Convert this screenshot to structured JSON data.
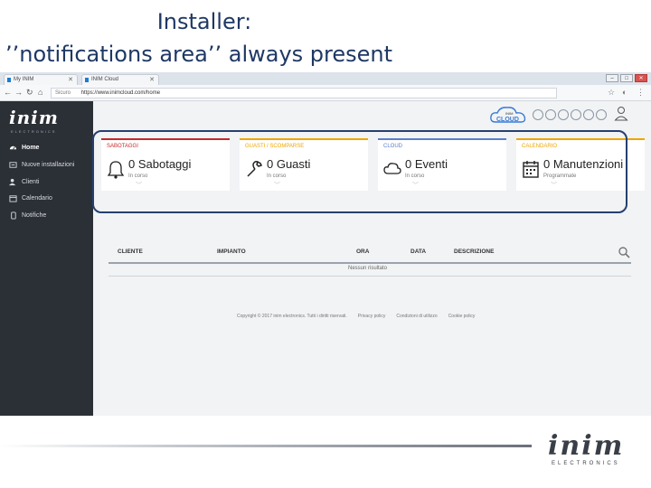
{
  "slide": {
    "title_line1": "Installer:",
    "title_line2": "’’notifications area’’ always present",
    "brand_name": "inim",
    "brand_sub": "ELECTRONICS"
  },
  "browser": {
    "tabs": [
      {
        "label": "My INIM"
      },
      {
        "label": "INIM Cloud"
      }
    ],
    "url_security": "Sicuro",
    "url": "https://www.inimcloud.com/home"
  },
  "sidebar": {
    "logo": "inim",
    "logo_sub": "ELECTRONICS",
    "items": [
      {
        "label": "Home",
        "icon": "dashboard-icon",
        "active": true
      },
      {
        "label": "Nuove installazioni",
        "icon": "install-icon",
        "active": false
      },
      {
        "label": "Clienti",
        "icon": "users-icon",
        "active": false
      },
      {
        "label": "Calendario",
        "icon": "calendar-icon",
        "active": false
      },
      {
        "label": "Notifiche",
        "icon": "mobile-icon",
        "active": false
      }
    ]
  },
  "header": {
    "cloud_logo_top": "INIM",
    "cloud_logo_text": "CLOUD"
  },
  "cards": [
    {
      "title": "SABOTAGGI",
      "value": "0 Sabotaggi",
      "sub": "In corso",
      "icon": "bell-icon",
      "color": "#c62828"
    },
    {
      "title": "GUASTI / SCOMPARSE",
      "value": "0 Guasti",
      "sub": "In corso",
      "icon": "wrench-icon",
      "color": "#f0a500"
    },
    {
      "title": "CLOUD",
      "value": "0 Eventi",
      "sub": "In corso",
      "icon": "cloud-icon",
      "color": "#5b7fc7"
    },
    {
      "title": "CALENDARIO",
      "value": "0 Manutenzioni",
      "sub": "Programmate",
      "icon": "calendar-icon",
      "color": "#f0a500"
    }
  ],
  "table": {
    "columns": [
      "CLIENTE",
      "IMPIANTO",
      "ORA",
      "DATA",
      "DESCRIZIONE"
    ],
    "empty_text": "Nessun risultato"
  },
  "footer": {
    "copyright": "Copyright © 2017 inim electronics. Tutti i diritti riservati.",
    "links": [
      "Privacy policy",
      "Condizioni di utilizzo",
      "Cookie policy"
    ]
  }
}
